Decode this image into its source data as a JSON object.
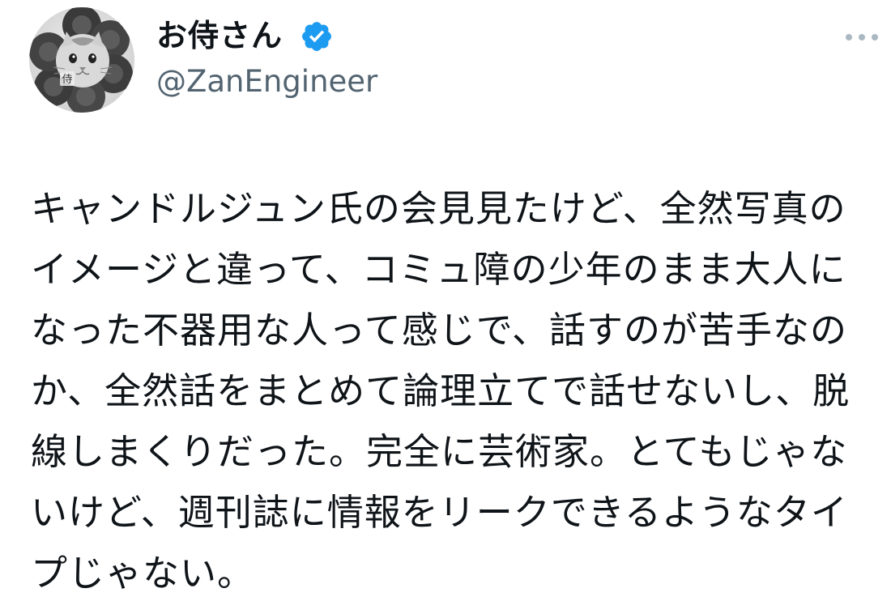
{
  "author": {
    "display_name": "お侍さん",
    "handle": "@ZanEngineer",
    "avatar_label": "侍",
    "verified": true
  },
  "icons": {
    "verified": "verified-badge-icon",
    "more": "more-horizontal-icon"
  },
  "colors": {
    "text": "#0f1419",
    "handle": "#536471",
    "verified": "#1d9bf0",
    "more_dots": "#aab8c2"
  },
  "tweet": {
    "lines": [
      "キャンドルジュン氏の会見見たけど、全然写真の",
      "イメージと違って、コミュ障の少年のまま大人に",
      "なった不器用な人って感じで、話すのが苦手なの",
      "か、全然話をまとめて論理立てで話せないし、脱",
      "線しまくりだった。完全に芸術家。とてもじゃな",
      "いけど、週刊誌に情報をリークできるようなタイ",
      "プじゃない。"
    ]
  }
}
